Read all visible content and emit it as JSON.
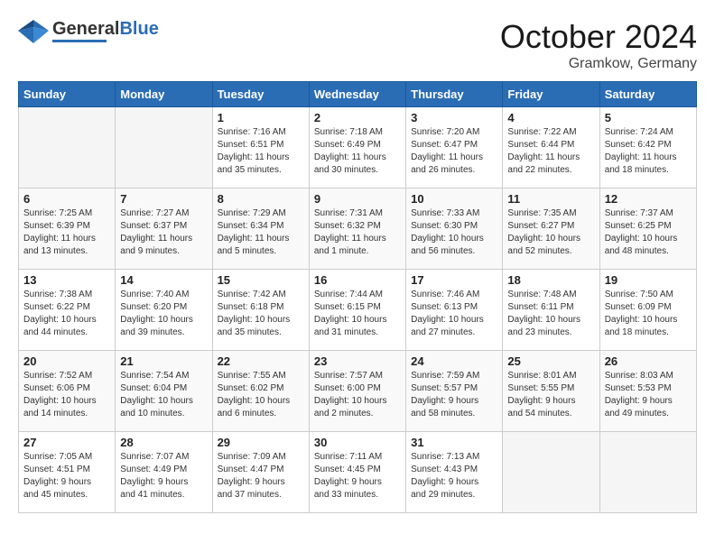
{
  "header": {
    "logo_general": "General",
    "logo_blue": "Blue",
    "month_title": "October 2024",
    "subtitle": "Gramkow, Germany"
  },
  "weekdays": [
    "Sunday",
    "Monday",
    "Tuesday",
    "Wednesday",
    "Thursday",
    "Friday",
    "Saturday"
  ],
  "weeks": [
    [
      {
        "day": "",
        "info": ""
      },
      {
        "day": "",
        "info": ""
      },
      {
        "day": "1",
        "info": "Sunrise: 7:16 AM\nSunset: 6:51 PM\nDaylight: 11 hours\nand 35 minutes."
      },
      {
        "day": "2",
        "info": "Sunrise: 7:18 AM\nSunset: 6:49 PM\nDaylight: 11 hours\nand 30 minutes."
      },
      {
        "day": "3",
        "info": "Sunrise: 7:20 AM\nSunset: 6:47 PM\nDaylight: 11 hours\nand 26 minutes."
      },
      {
        "day": "4",
        "info": "Sunrise: 7:22 AM\nSunset: 6:44 PM\nDaylight: 11 hours\nand 22 minutes."
      },
      {
        "day": "5",
        "info": "Sunrise: 7:24 AM\nSunset: 6:42 PM\nDaylight: 11 hours\nand 18 minutes."
      }
    ],
    [
      {
        "day": "6",
        "info": "Sunrise: 7:25 AM\nSunset: 6:39 PM\nDaylight: 11 hours\nand 13 minutes."
      },
      {
        "day": "7",
        "info": "Sunrise: 7:27 AM\nSunset: 6:37 PM\nDaylight: 11 hours\nand 9 minutes."
      },
      {
        "day": "8",
        "info": "Sunrise: 7:29 AM\nSunset: 6:34 PM\nDaylight: 11 hours\nand 5 minutes."
      },
      {
        "day": "9",
        "info": "Sunrise: 7:31 AM\nSunset: 6:32 PM\nDaylight: 11 hours\nand 1 minute."
      },
      {
        "day": "10",
        "info": "Sunrise: 7:33 AM\nSunset: 6:30 PM\nDaylight: 10 hours\nand 56 minutes."
      },
      {
        "day": "11",
        "info": "Sunrise: 7:35 AM\nSunset: 6:27 PM\nDaylight: 10 hours\nand 52 minutes."
      },
      {
        "day": "12",
        "info": "Sunrise: 7:37 AM\nSunset: 6:25 PM\nDaylight: 10 hours\nand 48 minutes."
      }
    ],
    [
      {
        "day": "13",
        "info": "Sunrise: 7:38 AM\nSunset: 6:22 PM\nDaylight: 10 hours\nand 44 minutes."
      },
      {
        "day": "14",
        "info": "Sunrise: 7:40 AM\nSunset: 6:20 PM\nDaylight: 10 hours\nand 39 minutes."
      },
      {
        "day": "15",
        "info": "Sunrise: 7:42 AM\nSunset: 6:18 PM\nDaylight: 10 hours\nand 35 minutes."
      },
      {
        "day": "16",
        "info": "Sunrise: 7:44 AM\nSunset: 6:15 PM\nDaylight: 10 hours\nand 31 minutes."
      },
      {
        "day": "17",
        "info": "Sunrise: 7:46 AM\nSunset: 6:13 PM\nDaylight: 10 hours\nand 27 minutes."
      },
      {
        "day": "18",
        "info": "Sunrise: 7:48 AM\nSunset: 6:11 PM\nDaylight: 10 hours\nand 23 minutes."
      },
      {
        "day": "19",
        "info": "Sunrise: 7:50 AM\nSunset: 6:09 PM\nDaylight: 10 hours\nand 18 minutes."
      }
    ],
    [
      {
        "day": "20",
        "info": "Sunrise: 7:52 AM\nSunset: 6:06 PM\nDaylight: 10 hours\nand 14 minutes."
      },
      {
        "day": "21",
        "info": "Sunrise: 7:54 AM\nSunset: 6:04 PM\nDaylight: 10 hours\nand 10 minutes."
      },
      {
        "day": "22",
        "info": "Sunrise: 7:55 AM\nSunset: 6:02 PM\nDaylight: 10 hours\nand 6 minutes."
      },
      {
        "day": "23",
        "info": "Sunrise: 7:57 AM\nSunset: 6:00 PM\nDaylight: 10 hours\nand 2 minutes."
      },
      {
        "day": "24",
        "info": "Sunrise: 7:59 AM\nSunset: 5:57 PM\nDaylight: 9 hours\nand 58 minutes."
      },
      {
        "day": "25",
        "info": "Sunrise: 8:01 AM\nSunset: 5:55 PM\nDaylight: 9 hours\nand 54 minutes."
      },
      {
        "day": "26",
        "info": "Sunrise: 8:03 AM\nSunset: 5:53 PM\nDaylight: 9 hours\nand 49 minutes."
      }
    ],
    [
      {
        "day": "27",
        "info": "Sunrise: 7:05 AM\nSunset: 4:51 PM\nDaylight: 9 hours\nand 45 minutes."
      },
      {
        "day": "28",
        "info": "Sunrise: 7:07 AM\nSunset: 4:49 PM\nDaylight: 9 hours\nand 41 minutes."
      },
      {
        "day": "29",
        "info": "Sunrise: 7:09 AM\nSunset: 4:47 PM\nDaylight: 9 hours\nand 37 minutes."
      },
      {
        "day": "30",
        "info": "Sunrise: 7:11 AM\nSunset: 4:45 PM\nDaylight: 9 hours\nand 33 minutes."
      },
      {
        "day": "31",
        "info": "Sunrise: 7:13 AM\nSunset: 4:43 PM\nDaylight: 9 hours\nand 29 minutes."
      },
      {
        "day": "",
        "info": ""
      },
      {
        "day": "",
        "info": ""
      }
    ]
  ]
}
